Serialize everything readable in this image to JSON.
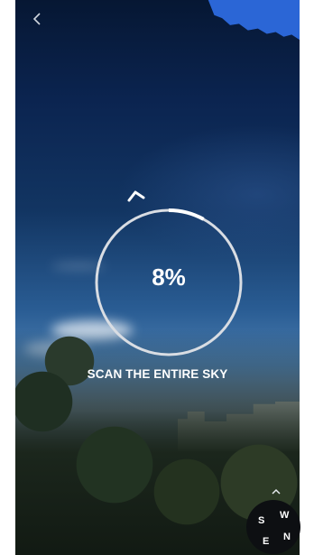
{
  "header": {
    "back_icon": "chevron-left-icon"
  },
  "scan": {
    "progress_percent": 8,
    "progress_label": "8%",
    "instruction": "SCAN THE ENTIRE SKY",
    "direction_icon": "chevron-up-icon"
  },
  "compass": {
    "letters": {
      "s": "S",
      "w": "W",
      "e": "E",
      "n": "N"
    },
    "toggle_icon": "chevron-up-icon"
  },
  "colors": {
    "ring": "#d9dde3",
    "accent_corner": "#2b66d6",
    "text": "#ffffff"
  }
}
